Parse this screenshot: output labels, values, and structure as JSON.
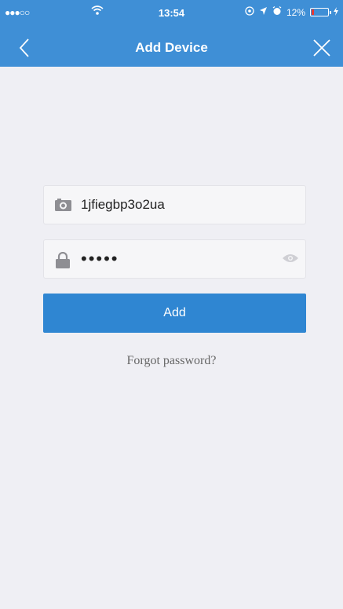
{
  "status_bar": {
    "carrier_signal": "●●●○○",
    "time": "13:54",
    "battery_percent": "12%",
    "battery_level": 0.12
  },
  "nav": {
    "title": "Add Device",
    "back_icon": "chevron-left-icon",
    "close_icon": "close-icon"
  },
  "form": {
    "device_id": {
      "value": "1jfiegbp3o2ua",
      "icon": "camera-icon"
    },
    "password": {
      "value": "•••••",
      "icon": "lock-icon",
      "toggle_icon": "eye-icon"
    },
    "add_label": "Add",
    "forgot_label": "Forgot password?"
  },
  "colors": {
    "header": "#3f8fd6",
    "button": "#2f86d2",
    "background": "#efeff4"
  }
}
